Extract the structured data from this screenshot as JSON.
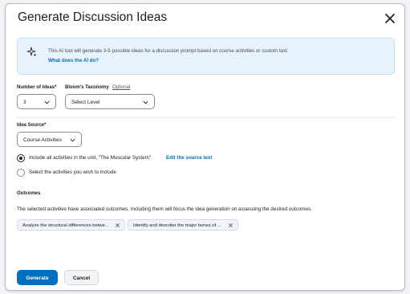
{
  "dialog": {
    "title": "Generate Discussion Ideas"
  },
  "banner": {
    "message": "This AI tool will generate 3-5 possible ideas for a discussion prompt based on course activities or custom text.",
    "link": "What does the AI do?"
  },
  "fields": {
    "num_ideas_label": "Number of Ideas",
    "required_mark": "*",
    "num_ideas_value": "3",
    "blooms_label": "Bloom's Taxonomy",
    "blooms_optional": "Optional",
    "blooms_value": "Select Level",
    "idea_source_label": "Idea Source",
    "idea_source_value": "Course Activities"
  },
  "options": {
    "include_all": "Include all activities in the unit, \"The Muscular System\"",
    "edit_source": "Edit the source text",
    "select_activities": "Select the activities you wish to include"
  },
  "outcomes": {
    "label": "Outcomes",
    "description": "The selected activities have associated outcomes. Including them will focus the idea generation on assessing the desired outcomes.",
    "chips": [
      "Analyze the structural differences betwe...",
      "Identify and describe the major bones of ..."
    ]
  },
  "footer": {
    "generate": "Generate",
    "cancel": "Cancel"
  },
  "colors": {
    "primary": "#006fbf",
    "banner_bg": "#e8f3fd"
  }
}
